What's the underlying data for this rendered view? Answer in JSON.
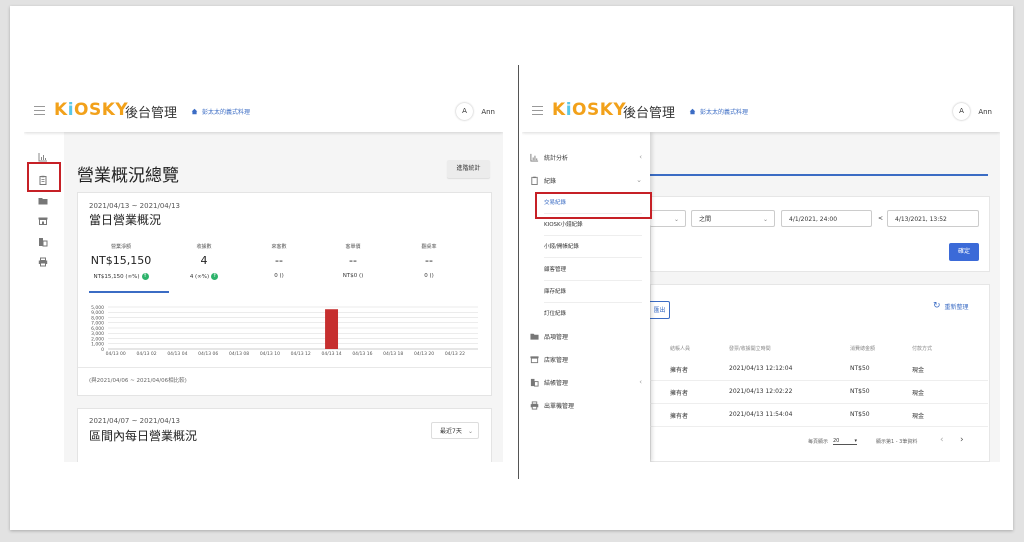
{
  "brand": {
    "logo_pre": "K",
    "logo_i": "i",
    "logo_post": "OSKY",
    "subtitle": "後台管理",
    "store": "彭太太的義式料理"
  },
  "user": {
    "avatar": "A",
    "name": "Ann"
  },
  "colors": {
    "accent": "#3b6cc4",
    "logo": "#f2a11a",
    "highlight": "#c62026",
    "positive": "#2db36b",
    "bar": "#c62f2f"
  },
  "left": {
    "page_title": "營業概況總覽",
    "advanced_button": "進階統計",
    "rail_icons": [
      "chart-icon",
      "clipboard-icon",
      "folder-icon",
      "store-icon",
      "building-icon",
      "printer-icon"
    ],
    "daily": {
      "date_range": "2021/04/13 ~ 2021/04/13",
      "title": "當日營業概況",
      "stats": [
        {
          "label": "營業淨額",
          "value": "NT$15,150",
          "compare": "NT$15,150 (∞%)",
          "up": true
        },
        {
          "label": "收據數",
          "value": "4",
          "compare": "4 (∞%)",
          "up": true
        },
        {
          "label": "來客數",
          "value": "--",
          "compare": "0 ()",
          "up": false
        },
        {
          "label": "客單價",
          "value": "--",
          "compare": "NT$0 ()",
          "up": false
        },
        {
          "label": "翻桌率",
          "value": "--",
          "compare": "0 ()",
          "up": false
        }
      ],
      "compare_note": "(與2021/04/06 ~ 2021/04/06相比較)"
    },
    "range": {
      "date_range": "2021/04/07 ~ 2021/04/13",
      "title": "區間內每日營業概況",
      "period_select": "最近7天"
    }
  },
  "chart_data": {
    "type": "bar",
    "categories": [
      "04/13 00",
      "04/13 01",
      "04/13 02",
      "04/13 03",
      "04/13 04",
      "04/13 05",
      "04/13 06",
      "04/13 07",
      "04/13 08",
      "04/13 09",
      "04/13 10",
      "04/13 11",
      "04/13 12",
      "04/13 13",
      "04/13 14",
      "04/13 15",
      "04/13 16",
      "04/13 17",
      "04/13 18",
      "04/13 19",
      "04/13 20",
      "04/13 21",
      "04/13 22",
      "04/13 23"
    ],
    "tick_labels": [
      "04/13 00",
      "04/13 02",
      "04/13 04",
      "04/13 06",
      "04/13 08",
      "04/13 10",
      "04/13 12",
      "04/13 14",
      "04/13 16",
      "04/13 18",
      "04/13 20",
      "04/13 22"
    ],
    "values": [
      0,
      0,
      0,
      0,
      0,
      0,
      0,
      0,
      0,
      0,
      0,
      0,
      0,
      0,
      15150,
      0,
      0,
      0,
      0,
      0,
      0,
      0,
      0,
      0
    ],
    "yticks": [
      "0",
      "1,000",
      "2,000",
      "3,000",
      "6,000",
      "7,000",
      "8,000",
      "9,000",
      "5,000"
    ],
    "ylim": [
      0,
      16000
    ],
    "grid": true
  },
  "right": {
    "nav": [
      {
        "label": "統計分析",
        "arrow": "‹"
      },
      {
        "label": "紀錄",
        "arrow": "⌄"
      }
    ],
    "sub": [
      "交易紀錄",
      "KIOSK小錢紀錄",
      "小錢/開帳紀錄",
      "顧客管理",
      "庫存紀錄",
      "訂位紀錄"
    ],
    "nav2": [
      {
        "label": "品項管理",
        "arrow": ""
      },
      {
        "label": "店家管理",
        "arrow": ""
      },
      {
        "label": "結帳管理",
        "arrow": "‹"
      },
      {
        "label": "出單機管理",
        "arrow": ""
      }
    ],
    "filter": {
      "op": "之間",
      "from": "4/1/2021, 24:00",
      "lt": "<",
      "to": "4/13/2021, 13:52",
      "ok": "確定"
    },
    "export_label": "匯出",
    "reorg_label": "重新整理",
    "table_headers": [
      "結帳人員",
      "發票/收據開立時間",
      "消費總金額",
      "付款方式"
    ],
    "rows": [
      {
        "staff": "擁有者",
        "time": "2021/04/13 12:12:04",
        "amount": "NT$50",
        "pay": "現金"
      },
      {
        "staff": "擁有者",
        "time": "2021/04/13 12:02:22",
        "amount": "NT$50",
        "pay": "現金"
      },
      {
        "staff": "擁有者",
        "time": "2021/04/13 11:54:04",
        "amount": "NT$50",
        "pay": "現金"
      }
    ],
    "pager": {
      "rows_label": "每頁顯示",
      "rows_value": "20",
      "range": "顯示第1 - 3筆資料"
    }
  }
}
